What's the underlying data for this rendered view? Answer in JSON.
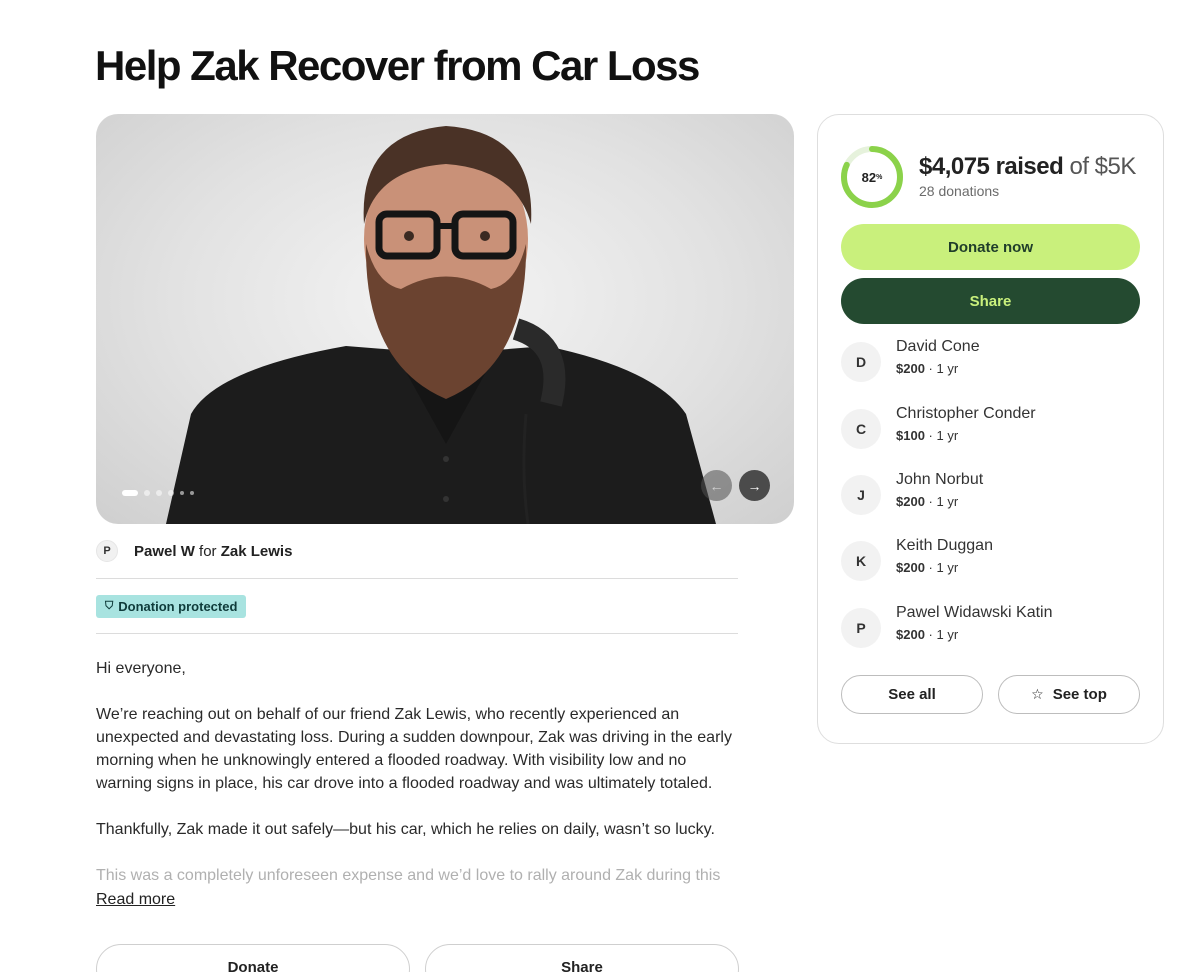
{
  "page": {
    "title": "Help Zak Recover from Car Loss"
  },
  "organizer": {
    "initial": "P",
    "name": "Pawel W",
    "connector": "for",
    "beneficiary": "Zak Lewis"
  },
  "badge": {
    "icon": "shield-icon",
    "label": "Donation protected"
  },
  "story": {
    "paragraphs": [
      "Hi everyone,",
      "We’re reaching out on behalf of our friend Zak Lewis, who recently experienced an unexpected and devastating loss. During a sudden downpour, Zak was driving in the early morning when he unknowingly entered a flooded roadway. With visibility low and no warning signs in place, his car drove into a flooded roadway and was ultimately totaled.",
      "Thankfully, Zak made it out safely—but his car, which he relies on daily, wasn’t so lucky.",
      "This was a completely unforeseen expense and we’d love to rally around Zak during this"
    ],
    "read_more": "Read more"
  },
  "gallery": {
    "slide_count": 5,
    "active_slide": 1,
    "prev_icon": "arrow-left-icon",
    "next_icon": "arrow-right-icon"
  },
  "bottom_actions": {
    "donate": "Donate",
    "share": "Share"
  },
  "fundraiser": {
    "percent": "82",
    "percent_sign": "%",
    "progress": 0.82,
    "raised": "$4,075 raised",
    "goal": "of $5K",
    "donations": "28 donations",
    "donate_label": "Donate now",
    "share_label": "Share",
    "see_all": "See all",
    "see_top": "See top",
    "accent_color": "#c9f07c",
    "dark_color": "#244a30",
    "ring_color": "#8bd24a"
  },
  "donors": [
    {
      "initial": "D",
      "name": "David Cone",
      "amount": "$200",
      "time": "1 yr"
    },
    {
      "initial": "C",
      "name": "Christopher Conder",
      "amount": "$100",
      "time": "1 yr"
    },
    {
      "initial": "J",
      "name": "John Norbut",
      "amount": "$200",
      "time": "1 yr"
    },
    {
      "initial": "K",
      "name": "Keith Duggan",
      "amount": "$200",
      "time": "1 yr"
    },
    {
      "initial": "P",
      "name": "Pawel Widawski Katin",
      "amount": "$200",
      "time": "1 yr"
    }
  ]
}
